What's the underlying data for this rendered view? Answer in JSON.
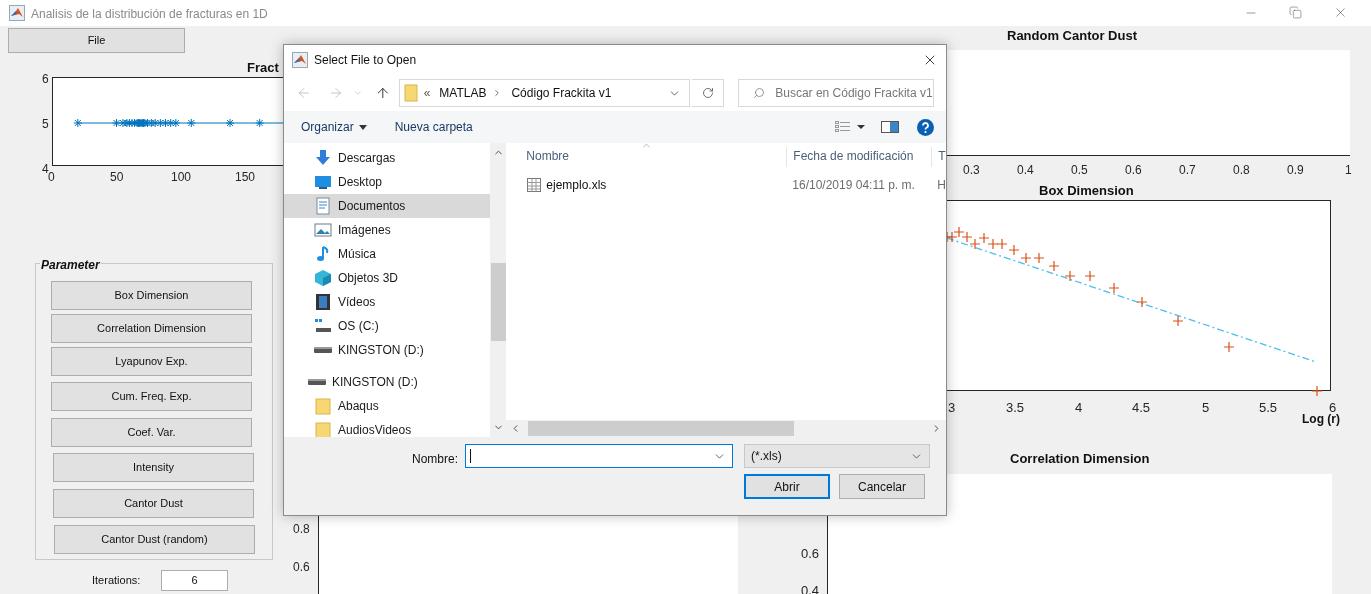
{
  "window": {
    "title": "Analisis de la distribución de fracturas en 1D"
  },
  "file_button": "File",
  "fracture_plot": {
    "title": "Fract",
    "yticks": [
      "6",
      "5",
      "4"
    ],
    "xticks": [
      "0",
      "50",
      "100",
      "150"
    ]
  },
  "parameter_panel": {
    "title": "Parameter",
    "buttons": [
      "Box Dimension",
      "Correlation Dimension",
      "Lyapunov Exp.",
      "Cum. Freq. Exp.",
      "Coef. Var.",
      "Intensity",
      "Cantor Dust",
      "Cantor Dust (random)"
    ]
  },
  "iterations": {
    "label": "Iterations:",
    "value": "6"
  },
  "lower_left_plot": {
    "yticks": [
      "0.8",
      "0.6"
    ]
  },
  "random_cantor_dust": {
    "title": "Random Cantor Dust",
    "xticks": [
      "0.3",
      "0.4",
      "0.5",
      "0.6",
      "0.7",
      "0.8",
      "0.9",
      "1"
    ]
  },
  "box_dimension": {
    "title": "Box Dimension",
    "xticks": [
      "3",
      "3.5",
      "4",
      "4.5",
      "5",
      "5.5",
      "6"
    ],
    "xlabel": "Log (r)"
  },
  "correlation_dimension": {
    "title": "Correlation Dimension",
    "yticks": [
      "0.6",
      "0.4"
    ]
  },
  "dialog": {
    "title": "Select File to Open",
    "breadcrumb": {
      "overflow": "«",
      "items": [
        "MATLAB",
        "Código Frackita v1"
      ]
    },
    "search": {
      "placeholder": "Buscar en Código Frackita v1"
    },
    "commands": [
      "Organizar",
      "Nueva carpeta"
    ],
    "nav": [
      {
        "label": "Descargas",
        "kind": "download",
        "selected": false
      },
      {
        "label": "Desktop",
        "kind": "desktop",
        "selected": false
      },
      {
        "label": "Documentos",
        "kind": "documents",
        "selected": true
      },
      {
        "label": "Imágenes",
        "kind": "images",
        "selected": false
      },
      {
        "label": "Música",
        "kind": "music",
        "selected": false
      },
      {
        "label": "Objetos 3D",
        "kind": "objects3d",
        "selected": false
      },
      {
        "label": "Vídeos",
        "kind": "videos",
        "selected": false
      },
      {
        "label": "OS (C:)",
        "kind": "osdrive",
        "selected": false
      },
      {
        "label": "KINGSTON (D:)",
        "kind": "drive",
        "selected": false
      },
      {
        "label": "KINGSTON (D:)",
        "kind": "drive",
        "selected": false,
        "children": [
          {
            "label": "Abaqus",
            "kind": "folder",
            "selected": false
          },
          {
            "label": "AudiosVideos",
            "kind": "folder",
            "selected": false
          }
        ]
      }
    ],
    "columns": [
      "Nombre",
      "Fecha de modificación",
      "T"
    ],
    "files": [
      {
        "name": "ejemplo.xls",
        "modified": "16/10/2019 04:11 p. m.",
        "column_3": "H"
      }
    ],
    "filename_label": "Nombre:",
    "filetype": "(*.xls)",
    "buttons": [
      {
        "label": "Abrir",
        "default": true
      },
      {
        "label": "Cancelar",
        "default": false
      }
    ]
  }
}
